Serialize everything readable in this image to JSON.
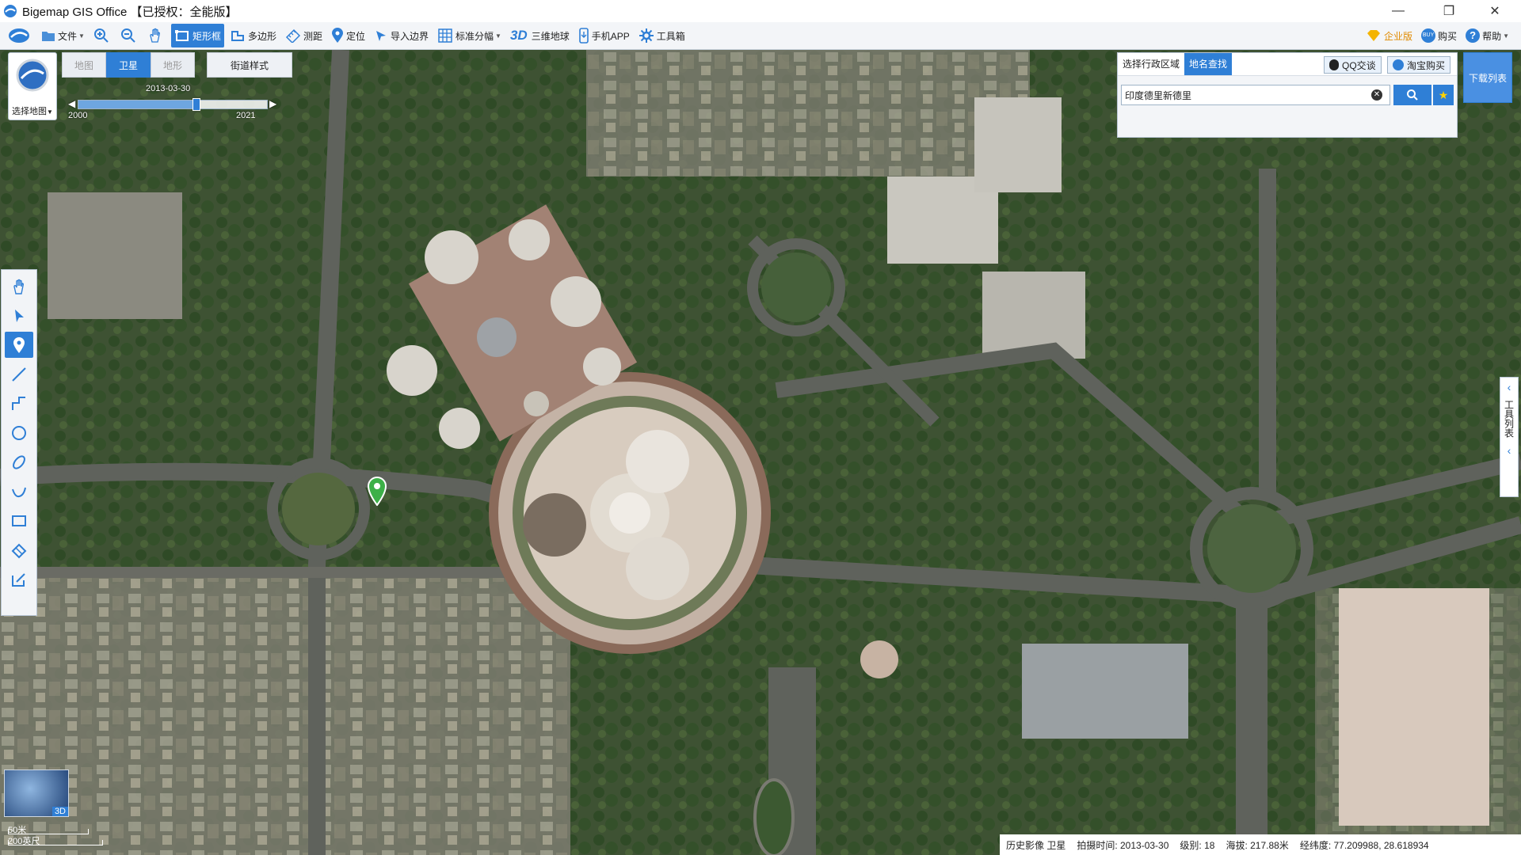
{
  "window": {
    "title": "Bigemap GIS Office 【已授权：全能版】",
    "minimize": "—",
    "maximize": "❐",
    "close": "✕"
  },
  "toolbar": {
    "items": [
      {
        "label": "文件",
        "icon": "folder-icon",
        "caret": true
      },
      {
        "label": "",
        "icon": "zoom-in-icon"
      },
      {
        "label": "",
        "icon": "zoom-out-icon"
      },
      {
        "label": "",
        "icon": "hand-icon"
      },
      {
        "label": "矩形框",
        "icon": "rect-select-icon",
        "active": true
      },
      {
        "label": "多边形",
        "icon": "polygon-icon"
      },
      {
        "label": "测距",
        "icon": "ruler-icon"
      },
      {
        "label": "定位",
        "icon": "locate-pin-icon"
      },
      {
        "label": "导入边界",
        "icon": "import-boundary-icon"
      },
      {
        "label": "标准分幅",
        "icon": "grid-icon",
        "caret": true
      },
      {
        "label": "三维地球",
        "icon": "3d-icon"
      },
      {
        "label": "手机APP",
        "icon": "phone-icon"
      },
      {
        "label": "工具箱",
        "icon": "gear-icon"
      }
    ],
    "right": [
      {
        "label": "企业版",
        "icon": "diamond-icon"
      },
      {
        "label": "购买",
        "icon": "buy-icon"
      },
      {
        "label": "帮助",
        "icon": "help-icon",
        "caret": true
      }
    ]
  },
  "map_selector": {
    "label": "选择地图"
  },
  "map_types": [
    {
      "label": "地图",
      "selected": false
    },
    {
      "label": "卫星",
      "selected": true
    },
    {
      "label": "地形",
      "selected": false
    }
  ],
  "street_style": "街道样式",
  "timeline": {
    "date": "2013-03-30",
    "start": "2000",
    "end": "2021",
    "position": 0.62
  },
  "left_tools": [
    "hand-icon",
    "pointer-icon",
    "marker-icon",
    "line-icon",
    "polyline-icon",
    "circle-icon",
    "ellipse-icon",
    "freeform-icon",
    "rectangle-icon",
    "eraser-icon",
    "edit-icon"
  ],
  "search": {
    "tabs": [
      {
        "label": "选择行政区域",
        "selected": false
      },
      {
        "label": "地名查找",
        "selected": true
      }
    ],
    "qq": "QQ交谈",
    "taobao": "淘宝购买",
    "query": "印度德里新德里"
  },
  "download_list": "下载列表",
  "side_tab": "工具列表",
  "globe": {
    "label": "3D"
  },
  "scale": {
    "metric": "50米",
    "imperial": "200英尺"
  },
  "status": {
    "imagery": "历史影像 卫星",
    "capture_time": "拍摄时间: 2013-03-30",
    "level": "级别: 18",
    "elevation": "海拔: 217.88米",
    "coords": "经纬度: 77.209988, 28.618934"
  }
}
